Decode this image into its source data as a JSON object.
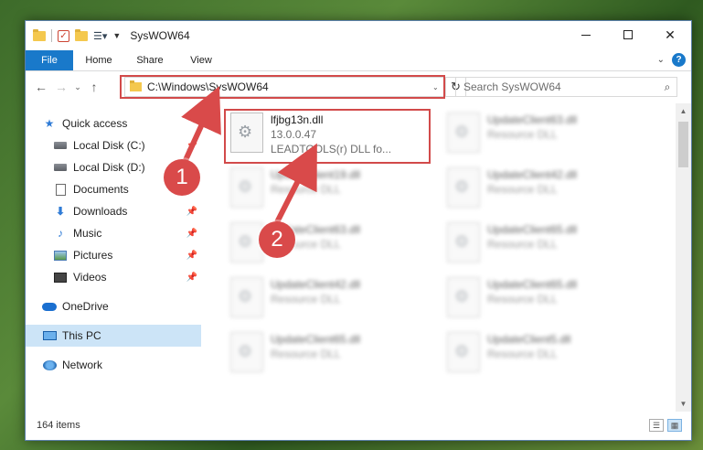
{
  "window": {
    "title": "SysWOW64"
  },
  "ribbon": {
    "tabs": [
      "File",
      "Home",
      "Share",
      "View"
    ],
    "help_label": "?"
  },
  "address": {
    "path": "C:\\Windows\\SysWOW64"
  },
  "search": {
    "placeholder": "Search SysWOW64"
  },
  "sidebar": {
    "items": [
      {
        "label": "Quick access",
        "icon": "star-icon"
      },
      {
        "label": "Local Disk (C:)",
        "icon": "disk-icon",
        "pinned": true
      },
      {
        "label": "Local Disk (D:)",
        "icon": "disk-icon",
        "pinned": false
      },
      {
        "label": "Documents",
        "icon": "document-icon",
        "pinned": false
      },
      {
        "label": "Downloads",
        "icon": "download-icon",
        "pinned": true
      },
      {
        "label": "Music",
        "icon": "music-icon",
        "pinned": true
      },
      {
        "label": "Pictures",
        "icon": "pictures-icon",
        "pinned": true
      },
      {
        "label": "Videos",
        "icon": "video-icon",
        "pinned": true
      },
      {
        "label": "OneDrive",
        "icon": "cloud-icon"
      },
      {
        "label": "This PC",
        "icon": "computer-icon",
        "selected": true
      },
      {
        "label": "Network",
        "icon": "network-icon"
      }
    ]
  },
  "files": {
    "highlighted": {
      "name": "lfjbg13n.dll",
      "version": "13.0.0.47",
      "description": "LEADTOOLS(r) DLL fo..."
    },
    "left_column": [
      {
        "name": "UpdateClient19.dll",
        "type": "Resource DLL"
      },
      {
        "name": "UpdateClient63.dll",
        "type": "Resource DLL"
      },
      {
        "name": "UpdateClient42.dll",
        "type": "Resource DLL"
      },
      {
        "name": "UpdateClient65.dll",
        "type": "Resource DLL"
      }
    ],
    "right_column": [
      {
        "name": "UpdateClient63.dll",
        "type": "Resource DLL"
      },
      {
        "name": "UpdateClient42.dll",
        "type": "Resource DLL"
      },
      {
        "name": "UpdateClient65.dll",
        "type": "Resource DLL"
      },
      {
        "name": "UpdateClient65.dll",
        "type": "Resource DLL"
      },
      {
        "name": "UpdateClient5.dll",
        "type": "Resource DLL"
      }
    ]
  },
  "status": {
    "item_count": "164 items"
  },
  "annotations": {
    "badge1": "1",
    "badge2": "2",
    "color": "#d94a4a"
  }
}
